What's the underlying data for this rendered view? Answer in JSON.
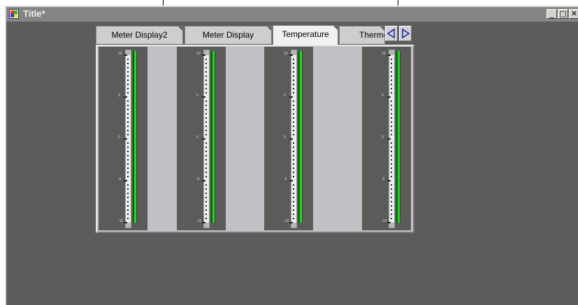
{
  "window": {
    "title": "Title*",
    "minimize": "_",
    "maximize": "□",
    "close": "✕"
  },
  "tabs": [
    {
      "label": "Meter Display2",
      "active": false
    },
    {
      "label": "Meter Display",
      "active": false
    },
    {
      "label": "Temperature",
      "active": true
    },
    {
      "label": "Thermo",
      "active": false
    }
  ],
  "tab_scroll": {
    "left_icon": "triangle-left-icon",
    "right_icon": "triangle-right-icon"
  },
  "meters": [
    {
      "name": "meter-1",
      "labels": [
        "10",
        "5",
        "0",
        "-5",
        "-10"
      ]
    },
    {
      "name": "meter-2",
      "labels": [
        "10",
        "5",
        "0",
        "-5",
        "-10"
      ]
    },
    {
      "name": "meter-3",
      "labels": [
        "10",
        "5",
        "0",
        "-5",
        "-10"
      ]
    },
    {
      "name": "meter-4",
      "labels": [
        "10",
        "5",
        "0",
        "-5",
        "-10"
      ]
    }
  ],
  "colors": {
    "background": "#5c5d5a",
    "panel": "#c3c1c5",
    "meter_green": "#22d62a",
    "meter_dark_green": "#0b5e10"
  }
}
